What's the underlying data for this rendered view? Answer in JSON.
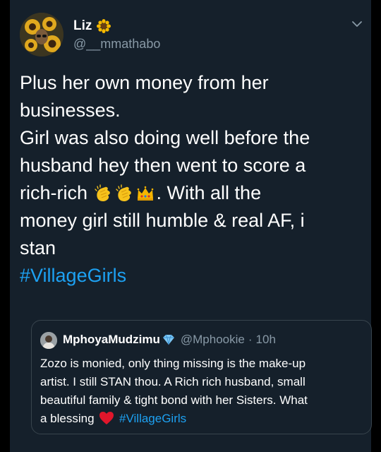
{
  "tweet": {
    "author": {
      "display_name": "Liz",
      "name_emoji": "sunflower-emoji",
      "handle": "@__mmathabo",
      "avatar": "profile-photo-sunflowers"
    },
    "menu_icon": "chevron-down-icon",
    "text_lines": [
      "Plus her own money from her",
      "businesses.",
      "Girl was also doing well before the",
      "husband hey then went to score a",
      "rich-rich",
      ". With all the",
      "money girl still humble & real AF, i",
      "stan"
    ],
    "inline_emojis": [
      "clapping-hands-emoji",
      "clapping-hands-emoji",
      "crown-emoji"
    ],
    "hashtag": "#VillageGirls",
    "colors": {
      "background": "#15202b",
      "text": "#ffffff",
      "secondary": "#8899a6",
      "link": "#1da1f2",
      "border": "#38444d"
    }
  },
  "quoted_tweet": {
    "display_name": "MphoyaMudzimu",
    "name_emoji": "gem-emoji",
    "handle": "@Mphookie",
    "separator": "·",
    "time": "10h",
    "text_lines": [
      "Zozo is monied, only thing missing is the make-up",
      "artist. I still STAN  thou. A Rich rich husband, small",
      "beautiful family & tight bond with her Sisters. What",
      "a blessing",
      "#VillageGirls"
    ],
    "inline_emoji": "red-heart-emoji"
  }
}
